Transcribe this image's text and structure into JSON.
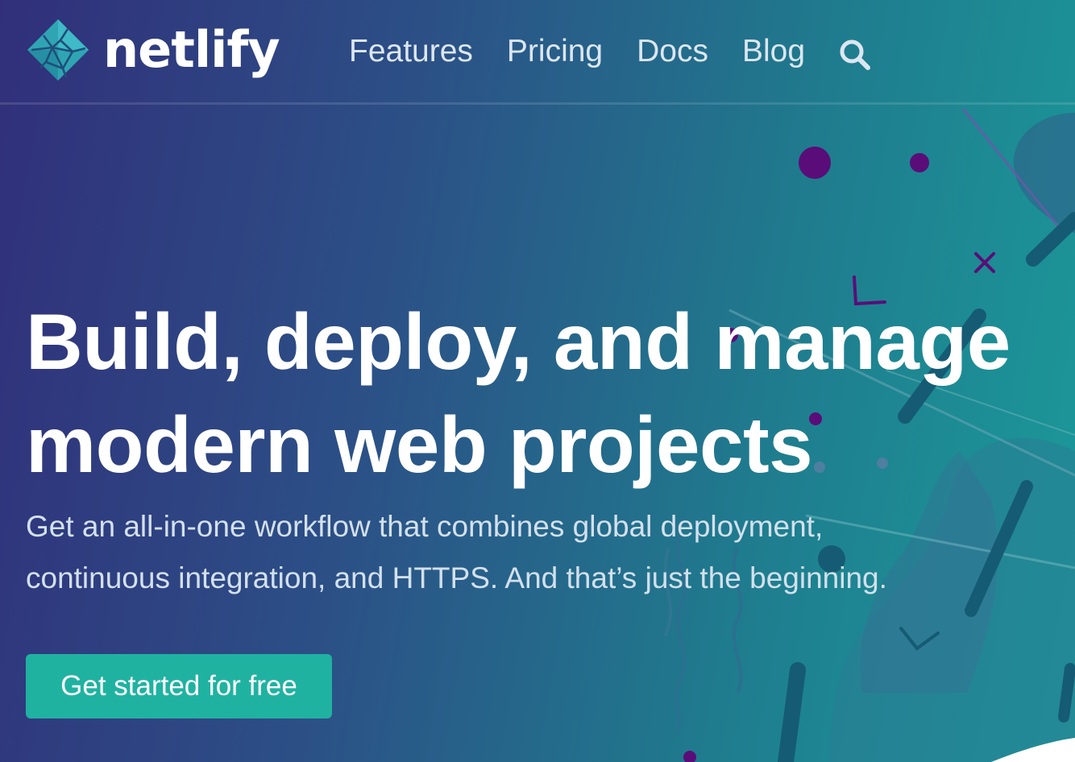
{
  "brand": {
    "name": "netlify",
    "logo_icon": "netlify-logo-icon"
  },
  "nav": {
    "links": [
      {
        "label": "Features"
      },
      {
        "label": "Pricing"
      },
      {
        "label": "Docs"
      },
      {
        "label": "Blog"
      }
    ],
    "search_icon": "search-icon"
  },
  "hero": {
    "title_lines": [
      "Build, deploy, and manage",
      "modern web projects"
    ],
    "subtitle_lines": [
      "Get an all-in-one workflow that combines global deployment,",
      "continuous integration, and HTTPS. And that’s just the beginning."
    ],
    "cta_label": "Get started for free"
  },
  "colors": {
    "gradient_start": "#312f7a",
    "gradient_end": "#1b9a9a",
    "accent_teal": "#20b2a1",
    "decor_purple": "#5a0d78",
    "decor_dark_teal": "#155b73"
  }
}
